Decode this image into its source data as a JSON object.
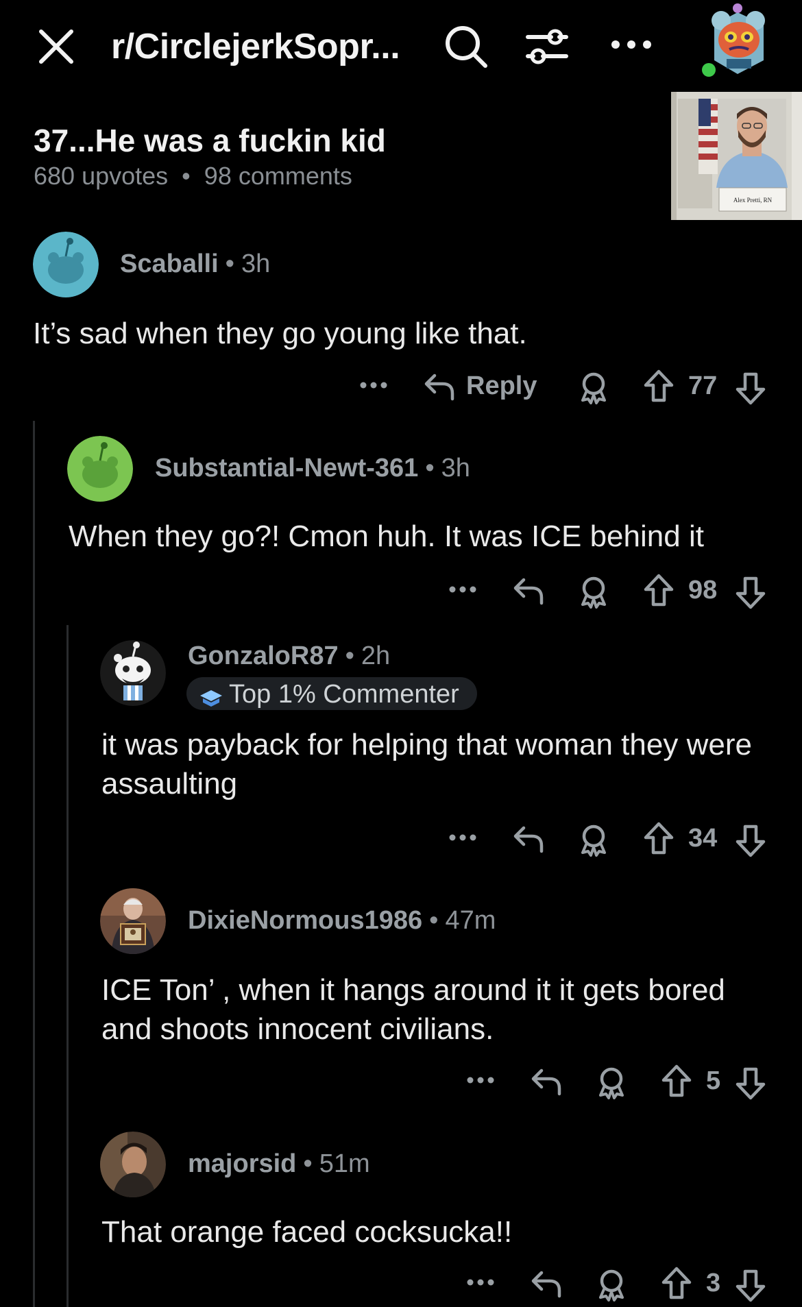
{
  "header": {
    "subreddit": "r/CirclejerkSopr...",
    "icons": [
      "close-icon",
      "search-icon",
      "filter-icon",
      "more-icon",
      "user-avatar"
    ]
  },
  "post": {
    "title": "37...He was a fuckin kid",
    "upvotes": "680 upvotes",
    "separator": "•",
    "comments": "98 comments",
    "thumb_caption": "Alex Pretti, RN"
  },
  "actions": {
    "reply_label": "Reply",
    "more_glyph": "•••"
  },
  "comments": [
    {
      "user": "Scaballi",
      "time": "3h",
      "body": "It’s sad when they go young like that.",
      "score": "77",
      "avatar_color": "#5bb6c9"
    },
    {
      "user": "Substantial-Newt-361",
      "time": "3h",
      "body": "When they go?! Cmon huh. It was ICE behind it",
      "score": "98",
      "avatar_color": "#7cc551"
    },
    {
      "user": "GonzaloR87",
      "time": "2h",
      "badge": "Top 1% Commenter",
      "body": "it was payback for helping that woman they were assaulting",
      "score": "34"
    },
    {
      "user": "DixieNormous1986",
      "time": "47m",
      "body": "ICE Ton’ , when it hangs around it it gets bored and shoots innocent civilians.",
      "score": "5"
    },
    {
      "user": "majorsid",
      "time": "51m",
      "body": "That orange faced cocksucka!!",
      "score": "3"
    }
  ]
}
